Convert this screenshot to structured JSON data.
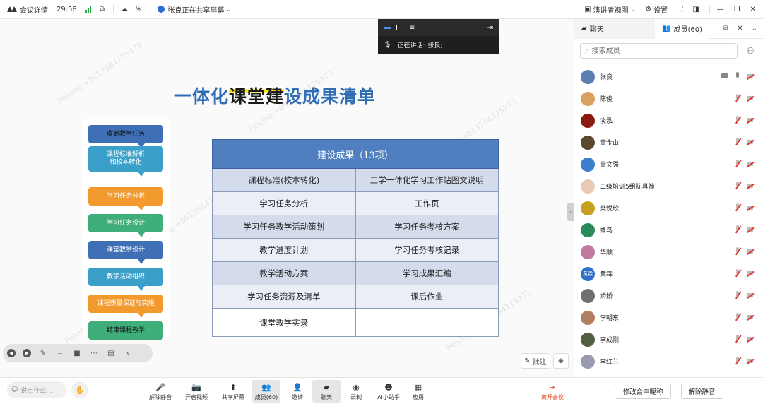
{
  "titlebar": {
    "app_label": "会议详情",
    "timer": "29:58",
    "sharing_status": "张良正在共享屏幕",
    "presenter_view": "演讲者视图",
    "settings": "设置"
  },
  "speaking": {
    "label": "正在讲话:",
    "name": "张良;"
  },
  "slide": {
    "title_part1": "一体化",
    "title_part2": "课堂建",
    "title_part3": "设成果清单",
    "flow_steps": [
      {
        "label": "收到教学任务",
        "color": "#3f6fb5"
      },
      {
        "label": "课程标准解析\n和校本转化",
        "color": "#3a9fc9"
      },
      {
        "label": "学习任务分析",
        "color": "#f29a2e"
      },
      {
        "label": "学习任务设计",
        "color": "#3fae7a"
      },
      {
        "label": "课堂教学设计",
        "color": "#3f6fb5"
      },
      {
        "label": "教学活动组织",
        "color": "#3a9fc9"
      },
      {
        "label": "课程质量保证与实施",
        "color": "#f29a2e"
      },
      {
        "label": "结束课程教学",
        "color": "#3fae7a"
      }
    ],
    "table": {
      "header": "建设成果（13项）",
      "rows": [
        [
          "课程标准(校本转化)",
          "工学一体化学习工作站图文说明"
        ],
        [
          "学习任务分析",
          "工作页"
        ],
        [
          "学习任务教学活动策划",
          "学习任务考核方案"
        ],
        [
          "教学进度计划",
          "学习任务考核记录"
        ],
        [
          "教学活动方案",
          "学习成果汇编"
        ],
        [
          "学习任务资源及清单",
          "课后作业"
        ],
        [
          "课堂教学实录",
          ""
        ]
      ]
    },
    "watermark": "Peiying +86135847753​73"
  },
  "stage_controls": {
    "annotate": "批注"
  },
  "bottombar": {
    "chat_placeholder": "说点什么...",
    "tools": [
      {
        "label": "解除静音",
        "icon": "mic-off-icon"
      },
      {
        "label": "开启视频",
        "icon": "camera-off-icon"
      },
      {
        "label": "共享屏幕",
        "icon": "share-screen-icon"
      },
      {
        "label": "成员(60)",
        "icon": "members-icon"
      },
      {
        "label": "邀请",
        "icon": "invite-icon"
      },
      {
        "label": "聊天",
        "icon": "chat-icon"
      },
      {
        "label": "录制",
        "icon": "record-icon"
      },
      {
        "label": "AI小助手",
        "icon": "ai-assistant-icon"
      },
      {
        "label": "应用",
        "icon": "apps-icon"
      },
      {
        "label": "离开会议",
        "icon": "leave-icon"
      }
    ]
  },
  "panel": {
    "tab_chat": "聊天",
    "tab_members": "成员(60)",
    "search_placeholder": "搜索成员",
    "members": [
      {
        "name": "张良",
        "color": "#5a7fb0",
        "host": true
      },
      {
        "name": "陈俊",
        "color": "#d9a060"
      },
      {
        "name": "淡泓",
        "color": "#8a1a10"
      },
      {
        "name": "董金山",
        "color": "#5b4630"
      },
      {
        "name": "董文强",
        "color": "#3a7fd0"
      },
      {
        "name": "二级培训5组陈真祯",
        "color": "#e9c9b4"
      },
      {
        "name": "樊悦欣",
        "color": "#c8a020"
      },
      {
        "name": "蜂鸟",
        "color": "#2a8a5a"
      },
      {
        "name": "华顺",
        "color": "#c07aa0"
      },
      {
        "name": "黄霖",
        "color": "#2f6fc8",
        "initials": "黄霖"
      },
      {
        "name": "娇娇",
        "color": "#707070"
      },
      {
        "name": "李朝东",
        "color": "#b08060"
      },
      {
        "name": "李成刚",
        "color": "#506040"
      },
      {
        "name": "李红兰",
        "color": "#9a9ab0"
      }
    ],
    "rename_button": "修改会中昵称",
    "unmute_button": "解除静音"
  }
}
